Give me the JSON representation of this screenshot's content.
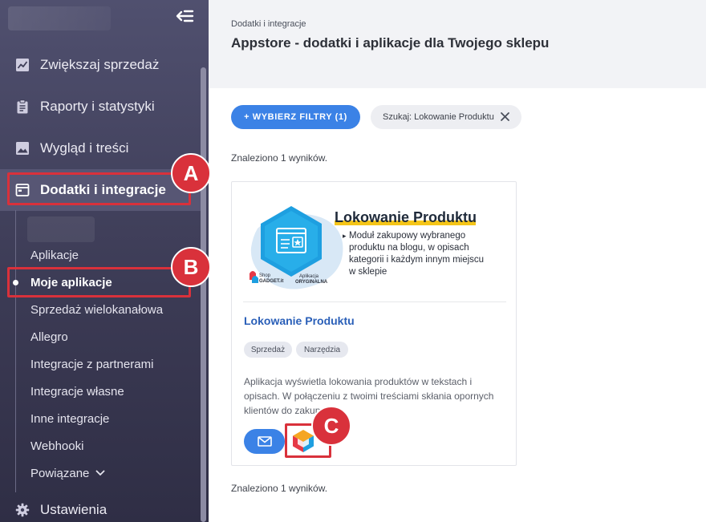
{
  "sidebar": {
    "items": [
      {
        "label": "Zwiększaj sprzedaż",
        "icon": "chart-line-icon"
      },
      {
        "label": "Raporty i statystyki",
        "icon": "clipboard-icon"
      },
      {
        "label": "Wygląd i treści",
        "icon": "image-icon"
      },
      {
        "label": "Dodatki i integracje",
        "icon": "window-icon"
      }
    ],
    "subitems": [
      "Aplikacje",
      "Moje aplikacje",
      "Sprzedaż wielokanałowa",
      "Allegro",
      "Integracje z partnerami",
      "Integracje własne",
      "Inne integracje",
      "Webhooki",
      "Powiązane"
    ],
    "settings_label": "Ustawienia"
  },
  "annotations": {
    "a": "A",
    "b": "B",
    "c": "C"
  },
  "header": {
    "breadcrumb": "Dodatki i integracje",
    "title": "Appstore - dodatki i aplikacje dla Twojego sklepu"
  },
  "filters": {
    "button_label": "+ WYBIERZ FILTRY (1)",
    "search_chip": "Szukaj: Lokowanie Produktu"
  },
  "results_text": "Znaleziono 1 wyników.",
  "card": {
    "banner_title": "Lokowanie Produktu",
    "banner_lines": [
      "Moduł zakupowy wybranego",
      "produktu na blogu, w opisach",
      "kategorii i każdym innym miejscu",
      "w sklepie"
    ],
    "banner_logo_shop": "Shop",
    "banner_logo_brand": "GADGET.it",
    "banner_badge_top": "Aplikacja",
    "banner_badge_bottom": "ORYGINALNA",
    "title": "Lokowanie Produktu",
    "tags": [
      "Sprzedaż",
      "Narzędzia"
    ],
    "description": "Aplikacja wyświetla lokowania produktów w tekstach i opisach. W połączeniu z twoimi treściami skłania opornych klientów do zakupu."
  },
  "colors": {
    "accent_blue": "#3b82e6",
    "annotation_red": "#d9313b",
    "sidebar_bg": "#3c3b55",
    "link_blue": "#2a5fb8"
  }
}
